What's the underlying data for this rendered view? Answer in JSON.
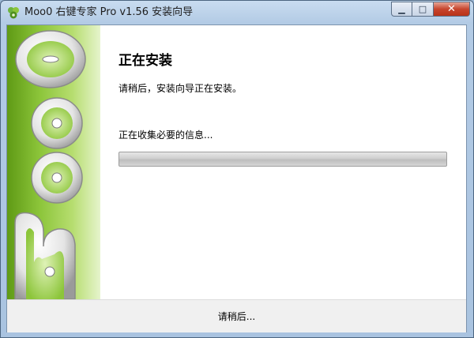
{
  "window": {
    "title": "Moo0 右键专家 Pro v1.56 安装向导",
    "minimize_glyph": "▁",
    "maximize_glyph": "□",
    "close_glyph": "✕"
  },
  "side_panel": {
    "logo_icon": "moo0-logo-icon",
    "accent_color": "#8cc53a"
  },
  "main": {
    "heading": "正在安装",
    "subheading": "请稍后，安装向导正在安装。",
    "status": "正在收集必要的信息...",
    "progress_fraction": 0
  },
  "footer": {
    "text": "请稍后..."
  }
}
